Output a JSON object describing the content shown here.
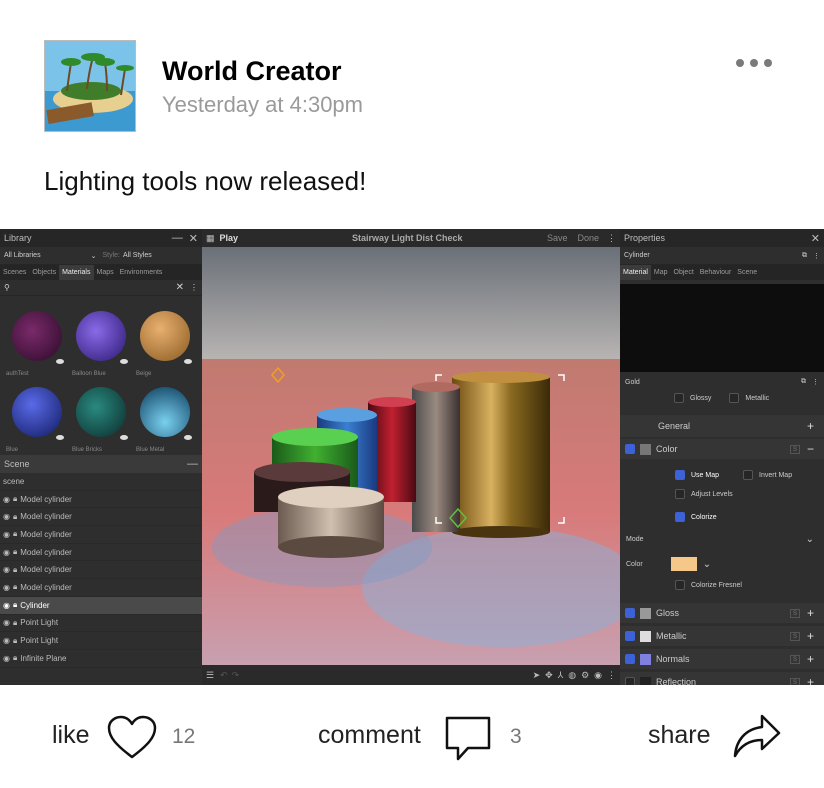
{
  "post": {
    "author": "World Creator",
    "timestamp": "Yesterday at 4:30pm",
    "text": "Lighting tools now released!"
  },
  "screenshot": {
    "library": {
      "title": "Library",
      "dropdown": "All Libraries",
      "style_label": "Style:",
      "style_value": "All Styles",
      "tabs": [
        "Scenes",
        "Objects",
        "Materials",
        "Maps",
        "Environments"
      ],
      "active_tab": "Materials",
      "materials": [
        {
          "label": "authTest",
          "color": "#3a1838"
        },
        {
          "label": "Balloon Blue",
          "color": "#5a3ab8"
        },
        {
          "label": "Beige",
          "color": "#c08a4a"
        },
        {
          "label": "Blue",
          "color": "#2a3aa0"
        },
        {
          "label": "Blue Bricks",
          "color": "#1a5050"
        },
        {
          "label": "Blue Metal",
          "color": "#1a6a8a"
        }
      ]
    },
    "scene": {
      "title": "Scene",
      "items": [
        "scene",
        "Model cylinder",
        "Model cylinder",
        "Model cylinder",
        "Model cylinder",
        "Model cylinder",
        "Model cylinder",
        "Cylinder",
        "Point Light",
        "Point Light",
        "Infinite Plane"
      ],
      "selected": "Cylinder"
    },
    "viewport": {
      "play_label": "Play",
      "title": "Stairway Light Dist Check",
      "save_label": "Save",
      "done_label": "Done"
    },
    "properties": {
      "title": "Properties",
      "object_name": "Cylinder",
      "tabs": [
        "Material",
        "Map",
        "Object",
        "Behaviour",
        "Scene"
      ],
      "active_tab": "Material",
      "material_name": "Gold",
      "glossy_label": "Glossy",
      "metallic_label": "Metallic",
      "general_label": "General",
      "color_label": "Color",
      "use_map_label": "Use Map",
      "invert_map_label": "Invert Map",
      "adjust_levels_label": "Adjust Levels",
      "colorize_label": "Colorize",
      "mode_label": "Mode",
      "color_field_label": "Color",
      "colorize_fresnel_label": "Colorize Fresnel",
      "layers": [
        "Gloss",
        "Metallic",
        "Normals",
        "Reflection"
      ],
      "swatch_color": "#f5c88a"
    }
  },
  "actions": {
    "like_label": "like",
    "like_count": "12",
    "comment_label": "comment",
    "comment_count": "3",
    "share_label": "share"
  }
}
